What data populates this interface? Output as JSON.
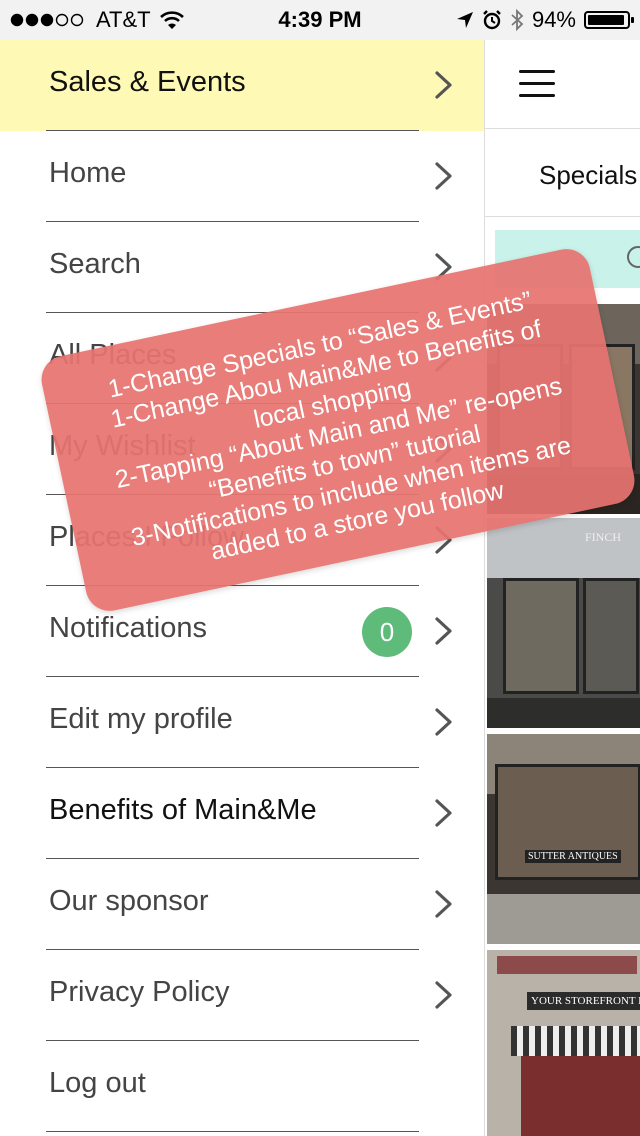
{
  "status_bar": {
    "carrier": "AT&T",
    "time": "4:39 PM",
    "battery": "94%",
    "battery_level": 0.94,
    "signal_bars": 3,
    "signal_total": 5
  },
  "menu": {
    "items": [
      {
        "label": "Sales & Events",
        "highlighted": true
      },
      {
        "label": "Home"
      },
      {
        "label": "Search"
      },
      {
        "label": "All Places"
      },
      {
        "label": "My Wishlist"
      },
      {
        "label": "Places I Follow"
      },
      {
        "label": "Notifications",
        "badge": "0"
      },
      {
        "label": "Edit my profile"
      },
      {
        "label": "Benefits of Main&Me"
      },
      {
        "label": "Our sponsor"
      },
      {
        "label": "Privacy Policy"
      },
      {
        "label": "Log out"
      }
    ]
  },
  "right_panel": {
    "tab_label": "Specials",
    "store_signs": [
      "FINCH",
      "SUTTER ANTIQUES",
      "YOUR STOREFRONT HERE"
    ]
  },
  "annotation": {
    "lines": [
      "1-Change Specials to “Sales & Events”",
      "1-Change Abou Main&Me to Benefits of",
      "local shopping",
      "2-Tapping “About Main and Me” re-opens",
      "“Benefits to town” tutorial",
      "3-Notifications to include when items are",
      "added to a store you follow"
    ]
  },
  "colors": {
    "highlight": "#fff9b6",
    "badge": "#5fbb7a",
    "annotation": "#e67370",
    "search_bar": "#c8f2ea"
  }
}
